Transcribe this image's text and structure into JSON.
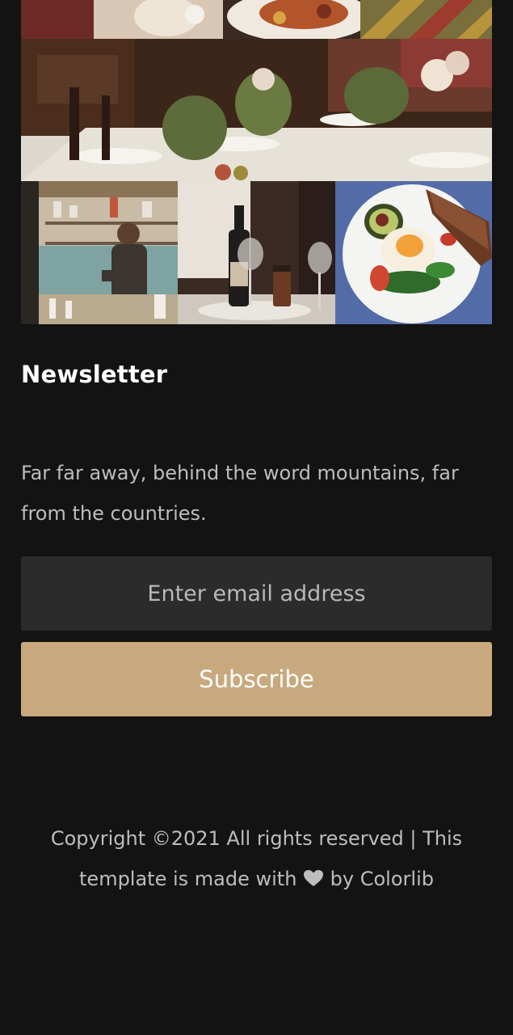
{
  "gallery": {
    "images": [
      {
        "name": "food-platter-photo"
      },
      {
        "name": "dining-table-photo"
      },
      {
        "name": "barista-photo"
      },
      {
        "name": "wine-bottle-photo"
      },
      {
        "name": "avocado-egg-plate-photo"
      }
    ]
  },
  "newsletter": {
    "title": "Newsletter",
    "text": "Far far away, behind the word mountains, far from the countries.",
    "email_placeholder": "Enter email address",
    "email_value": "",
    "subscribe_label": "Subscribe"
  },
  "footer": {
    "copyright_before": "Copyright ©2021 All rights reserved | This template is made with ",
    "heart_icon": "heart-icon",
    "copyright_after": " by Colorlib"
  },
  "colors": {
    "background": "#131313",
    "input_bg": "#2b2b2b",
    "accent": "#c8a97e"
  }
}
